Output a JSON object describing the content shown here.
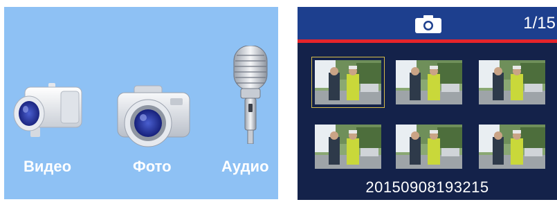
{
  "menu": {
    "items": [
      {
        "key": "video",
        "label": "Видео",
        "icon": "camcorder-icon"
      },
      {
        "key": "photo",
        "label": "Фото",
        "icon": "camera-icon"
      },
      {
        "key": "audio",
        "label": "Аудио",
        "icon": "microphone-icon"
      }
    ]
  },
  "gallery": {
    "header_icon": "camera-icon",
    "counter": "1/15",
    "filename": "20150908193215",
    "selected_index": 0,
    "thumbnails": [
      {
        "icon": "photo-thumbnail"
      },
      {
        "icon": "photo-thumbnail"
      },
      {
        "icon": "photo-thumbnail"
      },
      {
        "icon": "photo-thumbnail"
      },
      {
        "icon": "photo-thumbnail"
      },
      {
        "icon": "photo-thumbnail"
      }
    ]
  },
  "colors": {
    "menu_background": "#8ec1f4",
    "gallery_background": "#14224a",
    "header_bar": "#1d3f8e",
    "header_accent": "#e5242b",
    "selection_border": "#d8be4a"
  }
}
